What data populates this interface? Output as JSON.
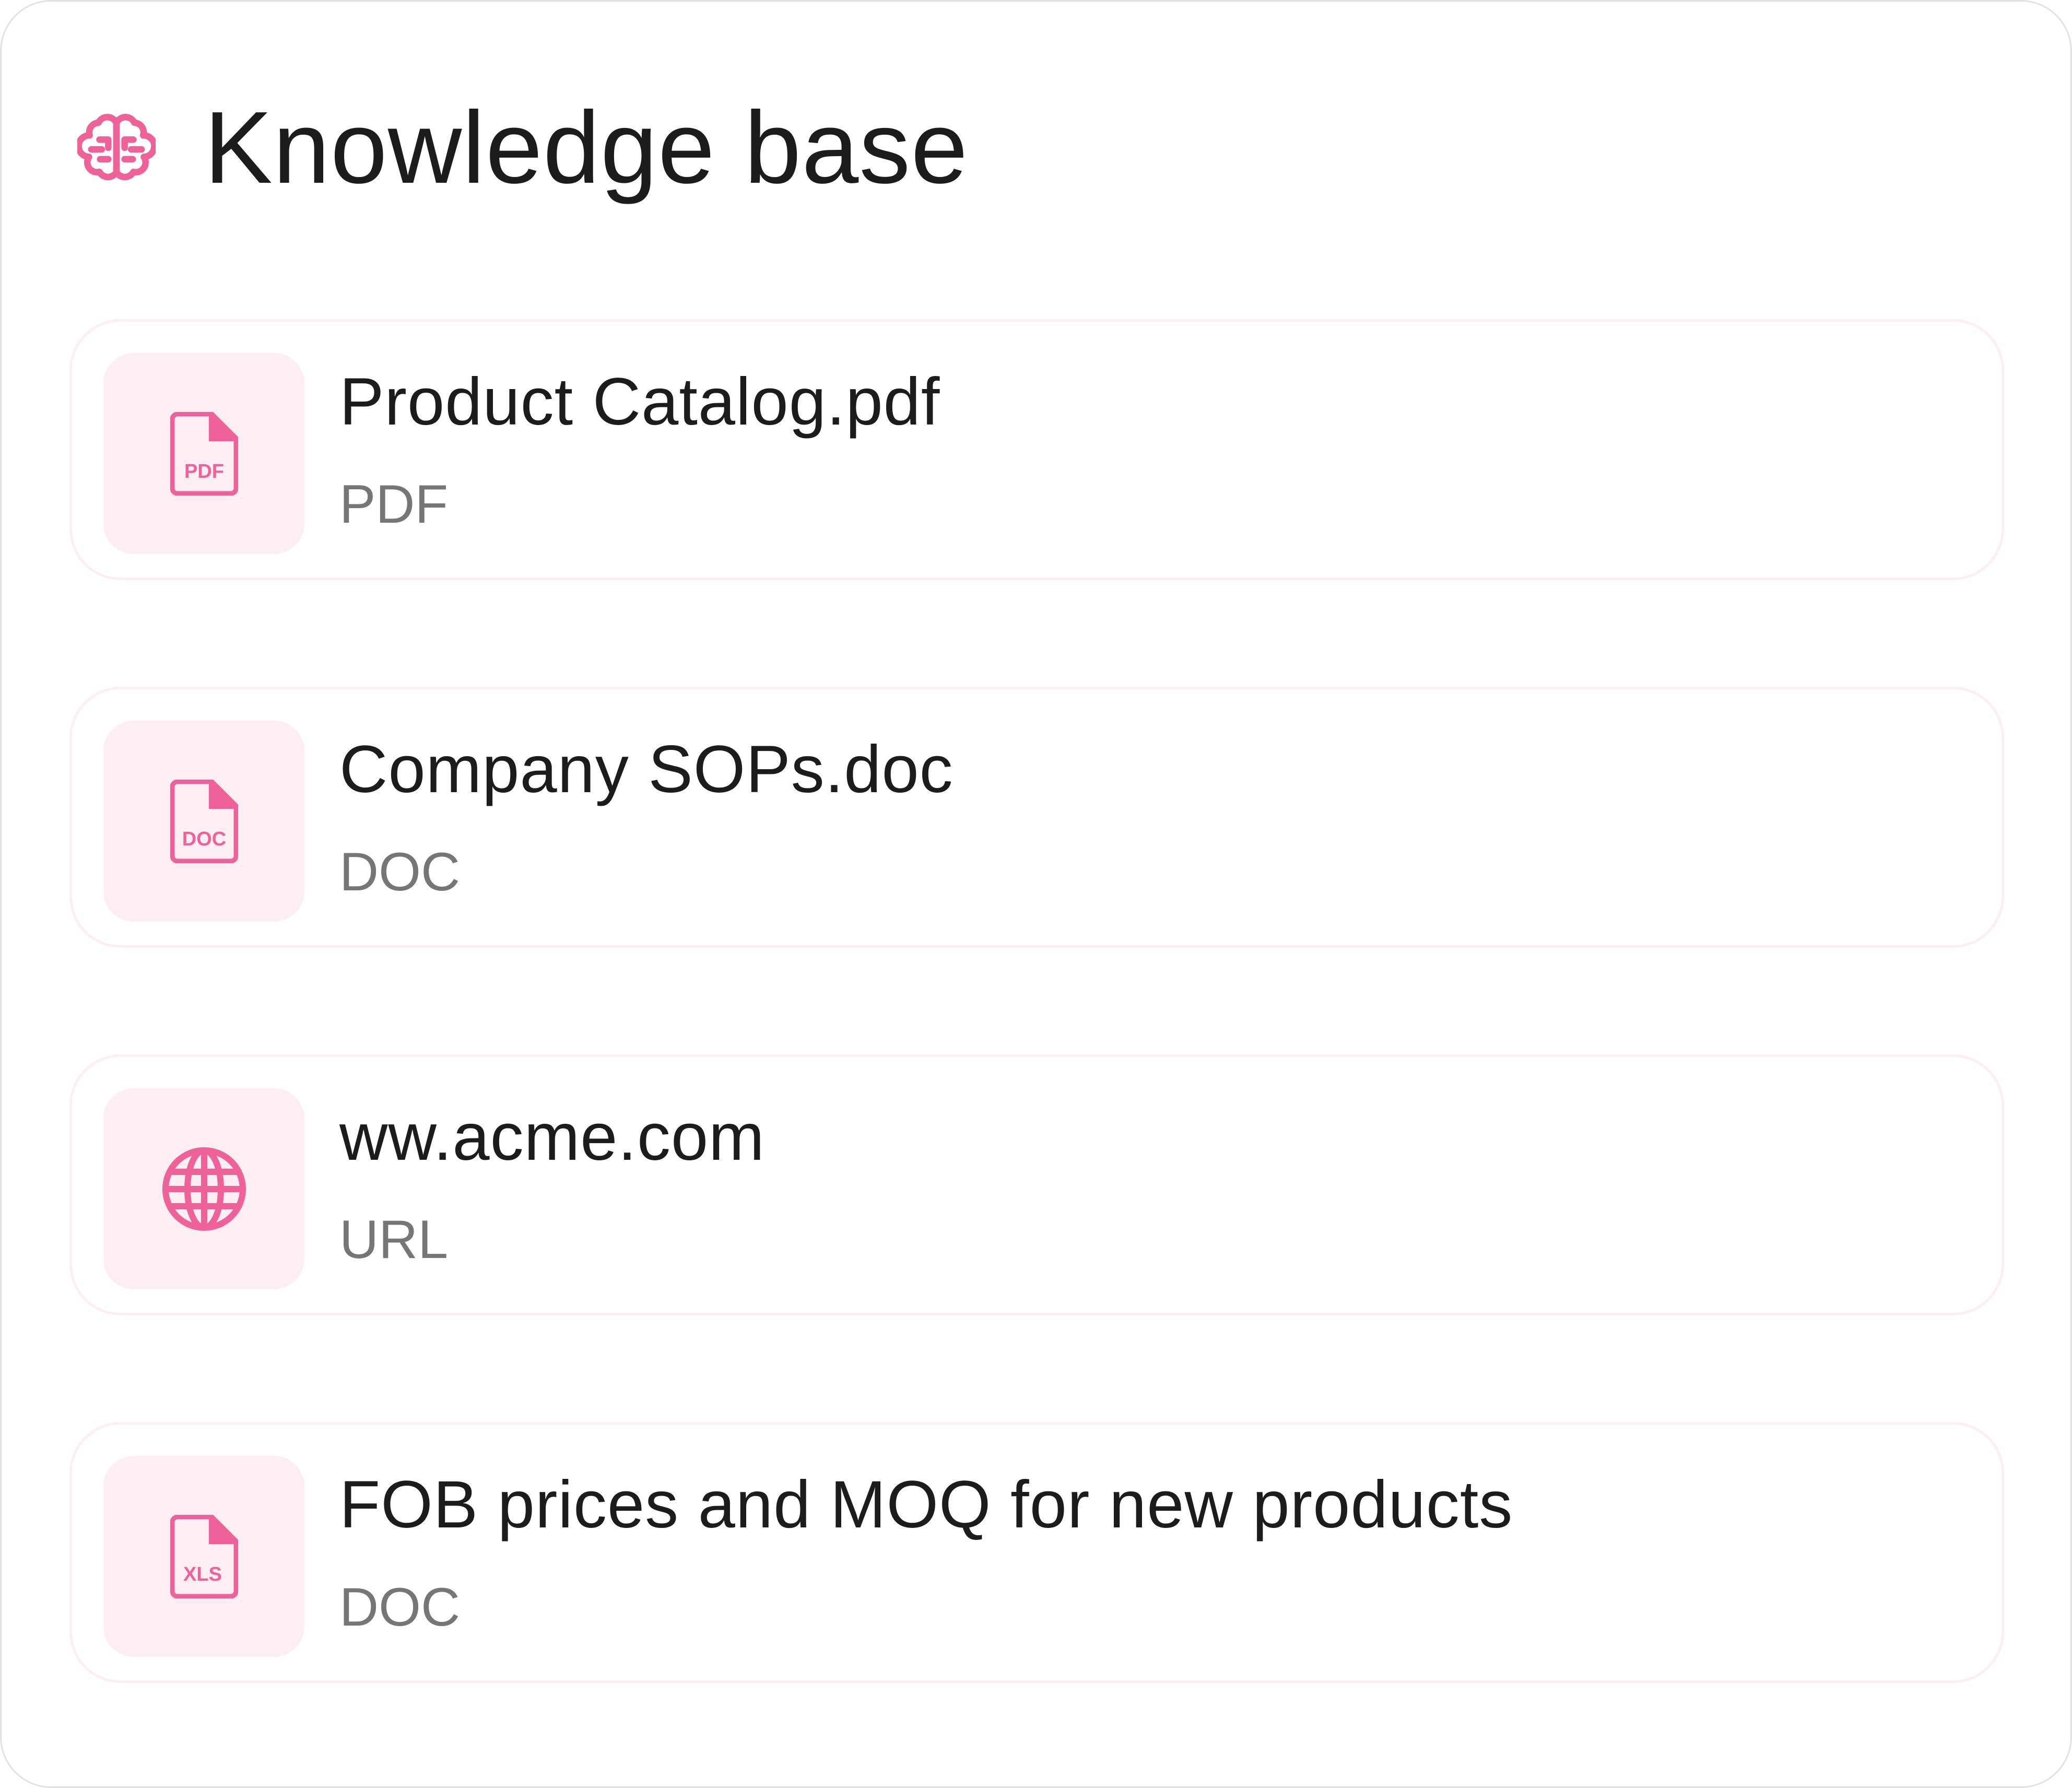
{
  "header": {
    "title": "Knowledge base",
    "icon": "brain-icon"
  },
  "accent_color": "#ef6199",
  "thumb_background": "#fdeef3",
  "items": [
    {
      "name": "Product Catalog.pdf",
      "type": "PDF",
      "icon": "pdf-file-icon",
      "icon_label": "PDF"
    },
    {
      "name": "Company SOPs.doc",
      "type": "DOC",
      "icon": "doc-file-icon",
      "icon_label": "DOC"
    },
    {
      "name": "ww.acme.com",
      "type": "URL",
      "icon": "globe-icon"
    },
    {
      "name": "FOB prices and MOQ for new products",
      "type": "DOC",
      "icon": "xls-file-icon",
      "icon_label": "XLS"
    }
  ]
}
